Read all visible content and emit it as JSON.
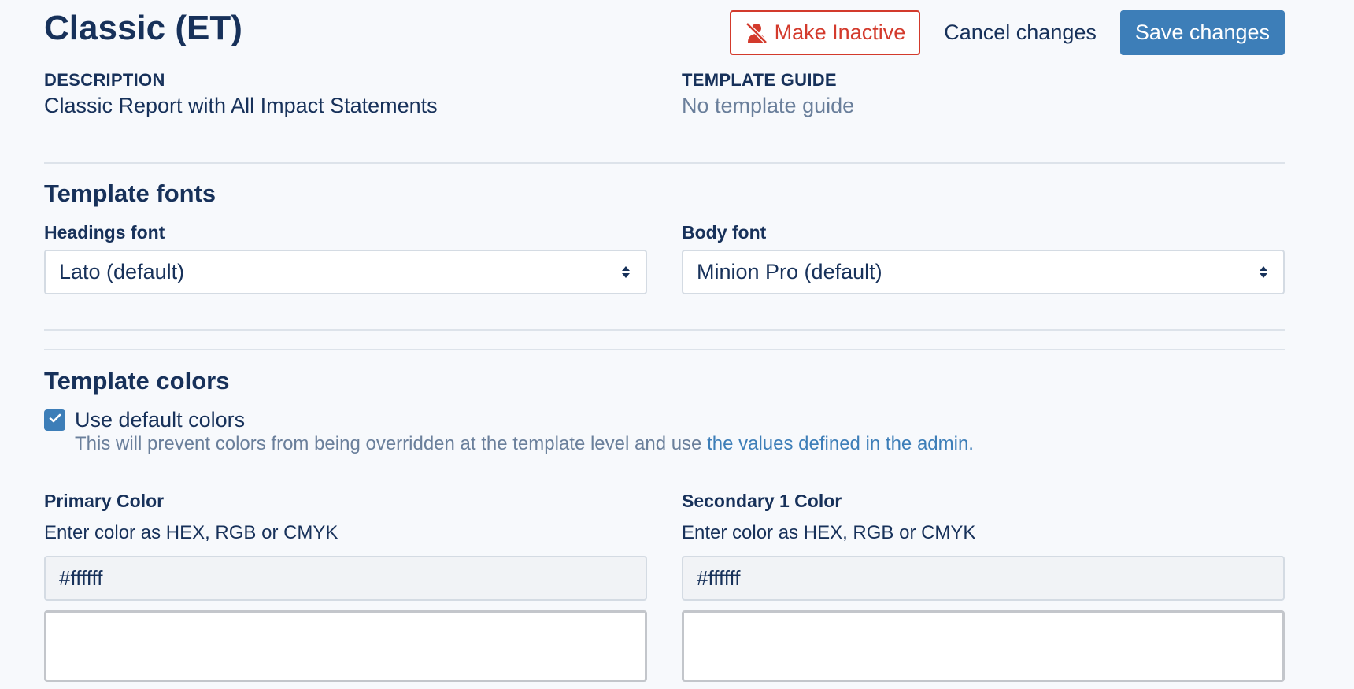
{
  "header": {
    "title": "Classic (ET)",
    "make_inactive_label": "Make Inactive",
    "cancel_label": "Cancel changes",
    "save_label": "Save changes"
  },
  "meta": {
    "description_label": "DESCRIPTION",
    "description_value": "Classic Report with All Impact Statements",
    "guide_label": "TEMPLATE GUIDE",
    "guide_value": "No template guide"
  },
  "fonts": {
    "section_title": "Template fonts",
    "headings_label": "Headings font",
    "headings_value": "Lato (default)",
    "body_label": "Body font",
    "body_value": "Minion Pro (default)"
  },
  "colors": {
    "section_title": "Template colors",
    "use_default_label": "Use default colors",
    "use_default_checked": true,
    "help_text": "This will prevent colors from being overridden at the template level and use ",
    "help_link": "the values defined in the admin.",
    "fields": [
      {
        "label": "Primary Color",
        "hint": "Enter color as HEX, RGB or CMYK",
        "value": "#ffffff",
        "swatch": "#ffffff"
      },
      {
        "label": "Secondary 1 Color",
        "hint": "Enter color as HEX, RGB or CMYK",
        "value": "#ffffff",
        "swatch": "#ffffff"
      }
    ]
  },
  "theme": {
    "accent": "#3d7eb8",
    "danger": "#d33a2c",
    "text": "#17315a",
    "muted": "#6a7f9b"
  }
}
